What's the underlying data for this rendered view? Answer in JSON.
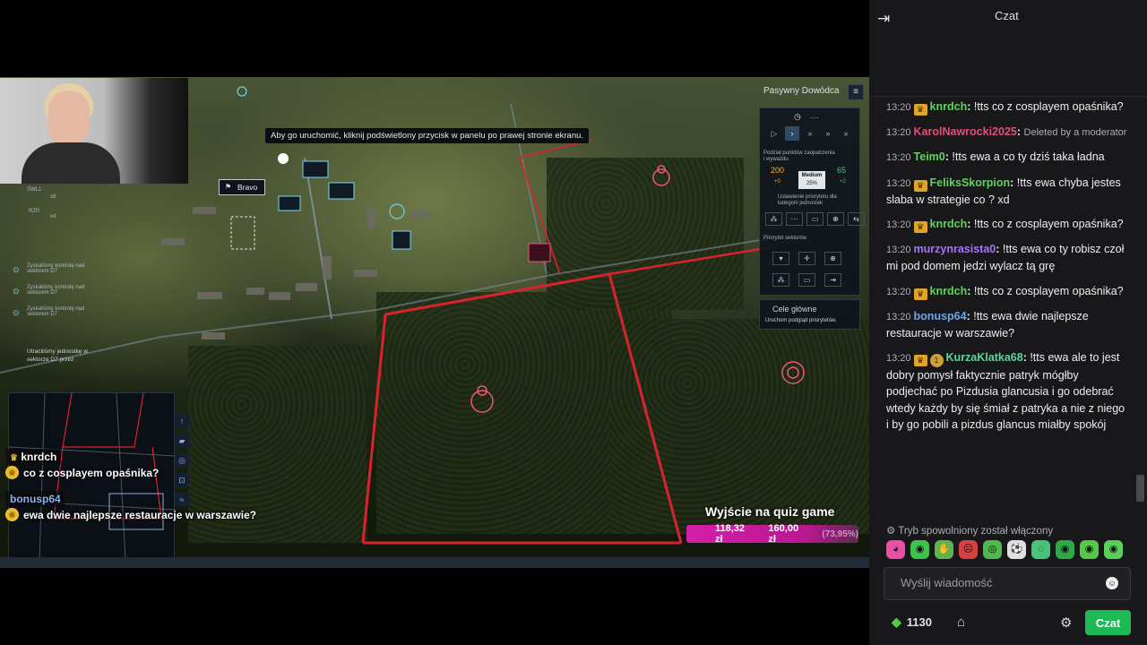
{
  "game": {
    "tooltip": "Aby go uruchomić, kliknij podświetlony przycisk w panelu po prawej stronie ekranu.",
    "unit_label": "Bravo",
    "commander_mode": "Pasywny Dowódca",
    "left_hud": {
      "swl": "ŚWL1",
      "swl_count": "x8",
      "rzp": "RZP.",
      "rzp_count": "x4",
      "objective_1": "Zyskaliśmy kontrolę nad sektorem D7",
      "objective_2": "Zyskaliśmy kontrolę nad sektorem D7",
      "objective_3": "Zyskaliśmy kontrolę nad sektorem D7",
      "lost_message_line1": "Utraciliśmy jednostkę w",
      "lost_message_line2": "sektorze D7 przez"
    },
    "right_hud": {
      "timer": "--:--",
      "supply_label": "Podział punktów zaopatrzenia i wyważdu",
      "supply_left_value": "200",
      "supply_left_delta": "+0",
      "supply_right_value": "65",
      "supply_right_delta": "+2",
      "supply_mode": "Medium",
      "supply_percent": "25%",
      "priority_label": "Ustawienie priorytetu dla kategorii jednostek",
      "sector_priority_label": "Priorytet sektorów",
      "goals_title": "Cele główne",
      "goals_sub": "Uruchom podgląd priorytetów."
    }
  },
  "overlay_chat": [
    {
      "user": "knrdch",
      "message": "co z cosplayem opaśnika?"
    },
    {
      "user": "bonusp64",
      "message": "ewa dwie najlepsze restauracje w warszawie?"
    }
  ],
  "quiz": {
    "title": "Wyjście na quiz game",
    "current": "118,32 zł",
    "goal": "160,00 zł",
    "percent": "(73,95%)"
  },
  "chat": {
    "header_title": "Czat",
    "messages": [
      {
        "ts": "13:20",
        "badge": "crown",
        "user": "knrdch",
        "color": "#5fd35a",
        "text": "!tts co z cosplayem opaśnika?"
      },
      {
        "ts": "13:20",
        "badge": "",
        "user": "KarolNawrocki2025",
        "color": "#e2507a",
        "text": "Deleted by a moderator",
        "deleted": true
      },
      {
        "ts": "13:20",
        "badge": "",
        "user": "Teim0",
        "color": "#5fd35a",
        "text": "!tts ewa a co ty dziś taka ładna"
      },
      {
        "ts": "13:20",
        "badge": "crown",
        "user": "FeliksSkorpion",
        "color": "#5fd35a",
        "text": "!tts ewa chyba jestes slaba w strategie co ? xd"
      },
      {
        "ts": "13:20",
        "badge": "crown",
        "user": "knrdch",
        "color": "#5fd35a",
        "text": "!tts co z cosplayem opaśnika?"
      },
      {
        "ts": "13:20",
        "badge": "",
        "user": "murzynrasista0",
        "color": "#a970ff",
        "text": "!tts ewa co ty robisz czoł mi pod domem jedzi wylacz tą grę"
      },
      {
        "ts": "13:20",
        "badge": "crown",
        "user": "knrdch",
        "color": "#5fd35a",
        "text": "!tts co z cosplayem opaśnika?"
      },
      {
        "ts": "13:20",
        "badge": "",
        "user": "bonusp64",
        "color": "#6fa6e6",
        "text": "!tts ewa dwie najlepsze restauracje w warszawie?"
      },
      {
        "ts": "13:20",
        "badge": "crown+1",
        "user": "KurzaKlatka68",
        "color": "#5fd3a0",
        "text": "!tts ewa ale to jest dobry pomysł faktycznie patryk mógłby podjechać po Pizdusia glancusia i go odebrać wtedy każdy by się śmiał z patryka a nie z niego i by go pobili a pizdus glancus miałby spokój"
      }
    ],
    "slow_mode": "Tryb spowolniony został włączony",
    "emotes": [
      "pink-emote",
      "green-emote",
      "hand-emote",
      "angry-emote",
      "frog-emote",
      "soccer-emote",
      "chat-emote",
      "pepe-emote",
      "pepe2-emote",
      "pepe3-emote"
    ],
    "input_placeholder": "Wyślij wiadomość",
    "points": "1130",
    "send_label": "Czat"
  },
  "colors": {
    "accent": "#1db954",
    "chat_bg": "#18181b",
    "quiz_bar": "#d51fa8",
    "sector_red": "#d8232f"
  }
}
